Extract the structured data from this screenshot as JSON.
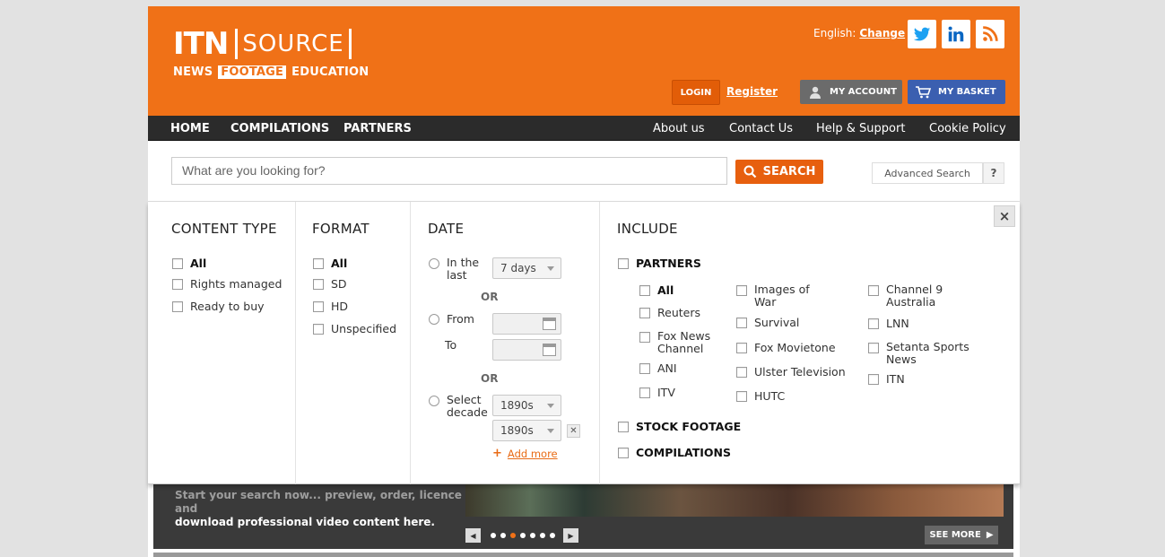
{
  "header": {
    "logo_main": "ITN",
    "logo_source": "SOURCE",
    "logo_news": "NEWS",
    "logo_footage": "FOOTAGE",
    "logo_education": "EDUCATION",
    "lang_label": "English:",
    "lang_change": "Change",
    "login": "LOGIN",
    "register": "Register",
    "my_account": "MY ACCOUNT",
    "my_basket": "MY BASKET",
    "brand_color": "#f07117"
  },
  "nav": {
    "left": [
      "HOME",
      "COMPILATIONS",
      "PARTNERS"
    ],
    "right": [
      "About us",
      "Contact Us",
      "Help & Support",
      "Cookie Policy"
    ]
  },
  "search": {
    "placeholder": "What are you looking for?",
    "button": "SEARCH",
    "advanced": "Advanced Search",
    "help": "?"
  },
  "filters": {
    "content_type": {
      "title": "CONTENT TYPE",
      "options": [
        "All",
        "Rights managed",
        "Ready to buy"
      ]
    },
    "format": {
      "title": "FORMAT",
      "options": [
        "All",
        "SD",
        "HD",
        "Unspecified"
      ]
    },
    "date": {
      "title": "DATE",
      "in_the_last_1": "In the",
      "in_the_last_2": "last",
      "in_the_last_value": "7 days",
      "or": "OR",
      "from": "From",
      "to": "To",
      "select_decade_1": "Select",
      "select_decade_2": "decade",
      "decade_1": "1890s",
      "decade_2": "1890s",
      "add_more": "Add more"
    },
    "include": {
      "title": "INCLUDE",
      "partners": "PARTNERS",
      "partners_col1": [
        [
          "All"
        ],
        [
          "Reuters"
        ],
        [
          "Fox News",
          "Channel"
        ],
        [
          "ANI"
        ],
        [
          "ITV"
        ]
      ],
      "partners_col2": [
        [
          "Images of",
          "War"
        ],
        [
          "Survival"
        ],
        [
          "Fox Movietone"
        ],
        [
          "Ulster Television"
        ],
        [
          "HUTC"
        ]
      ],
      "partners_col3": [
        [
          "Channel 9",
          "Australia"
        ],
        [
          "LNN"
        ],
        [
          "Setanta Sports",
          "News"
        ],
        [
          "ITN"
        ]
      ],
      "stock_footage": "STOCK FOOTAGE",
      "compilations": "COMPILATIONS"
    },
    "close": "×"
  },
  "hero": {
    "text_partial": "Start your search now... preview, order, licence and",
    "text": "download professional video content here.",
    "see_more": "SEE MORE"
  }
}
